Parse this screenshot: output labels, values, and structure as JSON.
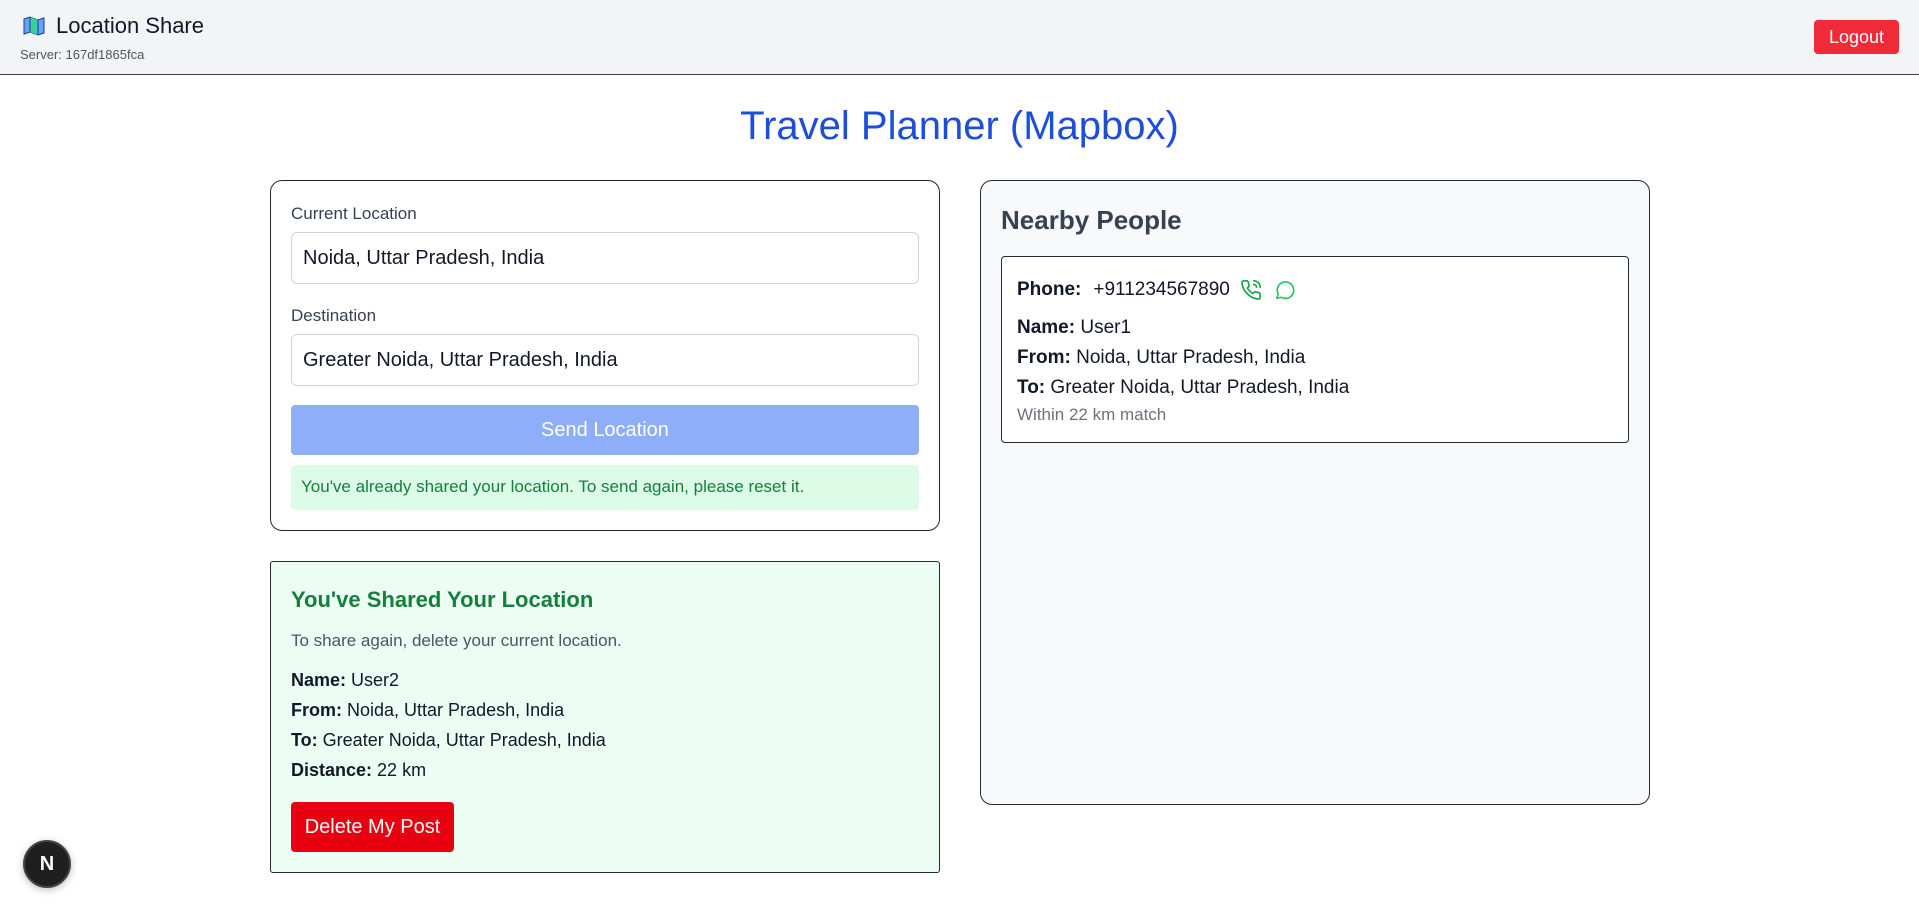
{
  "header": {
    "brand_icon": "map-icon",
    "title": "Location Share",
    "server": "Server: 167df1865fca",
    "logout_label": "Logout"
  },
  "page_title": "Travel Planner (Mapbox)",
  "form": {
    "current_label": "Current Location",
    "current_value": "Noida, Uttar Pradesh, India",
    "destination_label": "Destination",
    "destination_value": "Greater Noida, Uttar Pradesh, India",
    "send_label": "Send Location",
    "notice": "You've already shared your location. To send again, please reset it."
  },
  "shared": {
    "title": "You've Shared Your Location",
    "subtitle": "To share again, delete your current location.",
    "name_label": "Name:",
    "name": "User2",
    "from_label": "From:",
    "from": "Noida, Uttar Pradesh, India",
    "to_label": "To:",
    "to": "Greater Noida, Uttar Pradesh, India",
    "distance_label": "Distance:",
    "distance": "22 km",
    "delete_label": "Delete My Post"
  },
  "nearby": {
    "title": "Nearby People",
    "people": [
      {
        "phone_label": "Phone:",
        "phone": "+911234567890",
        "name_label": "Name:",
        "name": "User1",
        "from_label": "From:",
        "from": "Noida, Uttar Pradesh, India",
        "to_label": "To:",
        "to": "Greater Noida, Uttar Pradesh, India",
        "match": "Within 22 km match"
      }
    ]
  },
  "badge": {
    "label": "N"
  },
  "colors": {
    "accent": "#1d4ed8",
    "logout": "#ef2b3a",
    "delete": "#e80011",
    "send_disabled": "#8eaef9",
    "success_text": "#15803d",
    "success_bg": "#dcfce7"
  }
}
